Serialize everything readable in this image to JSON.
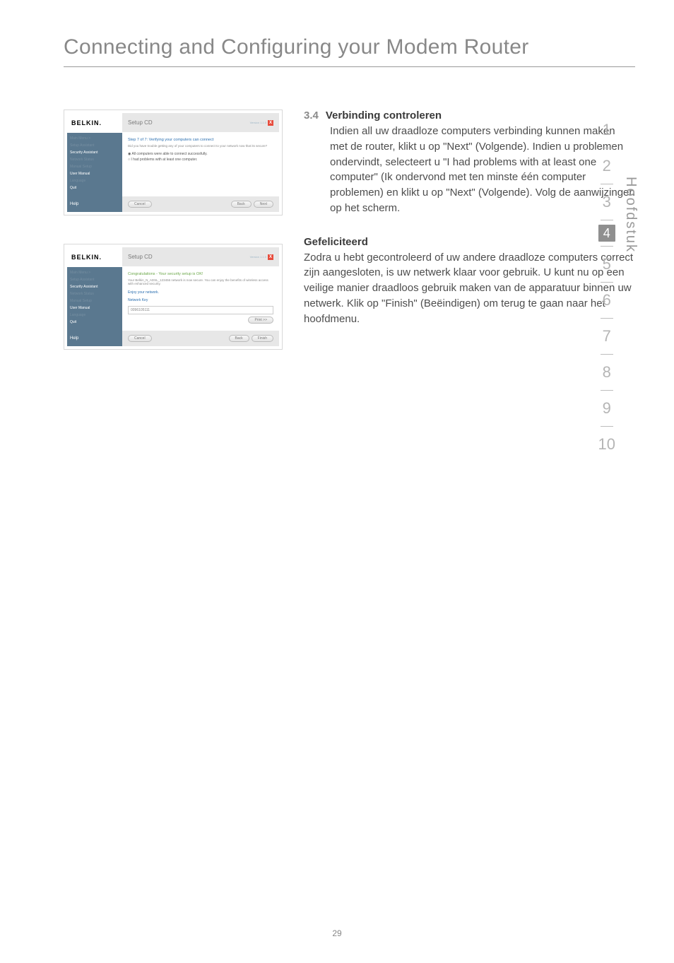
{
  "page": {
    "title": "Connecting and Configuring your Modem Router",
    "number": "29"
  },
  "sidebar": {
    "label": "Hoofdstuk",
    "items": [
      "1",
      "2",
      "3",
      "4",
      "5",
      "6",
      "7",
      "8",
      "9",
      "10"
    ],
    "active_index": 3
  },
  "section_34": {
    "number": "3.4",
    "title": "Verbinding controleren",
    "body": "Indien all uw draadloze computers verbinding kunnen maken met de router, klikt u op \"Next\" (Volgende). Indien u problemen ondervindt, selecteert u \"I had problems with at least one computer\" (Ik ondervond met ten minste één computer problemen) en klikt u op \"Next\" (Volgende). Volg de aanwijzingen op het scherm."
  },
  "congrats": {
    "title": "Gefeliciteerd",
    "body": "Zodra u hebt gecontroleerd of uw andere draadloze computers correct zijn aangesloten, is uw netwerk klaar voor gebruik. U kunt nu op een veilige manier draadloos gebruik maken van de apparatuur binnen uw netwerk. Klik op \"Finish\" (Beëindigen) om terug te gaan naar het hoofdmenu."
  },
  "screenshot1": {
    "logo": "BELKIN.",
    "header": "Setup CD",
    "version": "Version 1.1.0",
    "step_title": "Step 7 of 7: Verifying your computers can connect",
    "step_sub": "Did you have trouble getting any of your computers to connect to your network now that its secure?",
    "radio1": "All computers were able to connect successfully.",
    "radio2": "I had problems with at least one computer.",
    "nav": {
      "main_menu": "Main Menu >",
      "setup_assistant": "Setup Assistant",
      "security_assistant": "Security Assistant",
      "network_status": "Network Status",
      "manual_setup": "Manual Setup",
      "user_manual": "User Manual",
      "language": "Language",
      "quit": "Quit",
      "help": "Help"
    },
    "buttons": {
      "cancel": "Cancel",
      "back": "Back",
      "next": "Next"
    }
  },
  "screenshot2": {
    "logo": "BELKIN.",
    "header": "Setup CD",
    "version": "Version 1.1.0",
    "congrats_title": "Congratulations - Your security setup is OK!",
    "congrats_sub": "Your Belkin_N_ADSL_123456 network is now secure. You can enjoy the benefits of wireless access with enhanced security.",
    "enjoy": "Enjoy your network.",
    "key_label": "Network Key",
    "key_value": "0096105111",
    "print": "Print >>",
    "nav": {
      "main_menu": "Main Menu >",
      "setup_assistant": "Setup Assistant",
      "security_assistant": "Security Assistant",
      "network_status": "Network Status",
      "manual_setup": "Manual Setup",
      "user_manual": "User Manual",
      "language": "Language",
      "quit": "Quit",
      "help": "Help"
    },
    "buttons": {
      "cancel": "Cancel",
      "back": "Back",
      "finish": "Finish"
    }
  }
}
